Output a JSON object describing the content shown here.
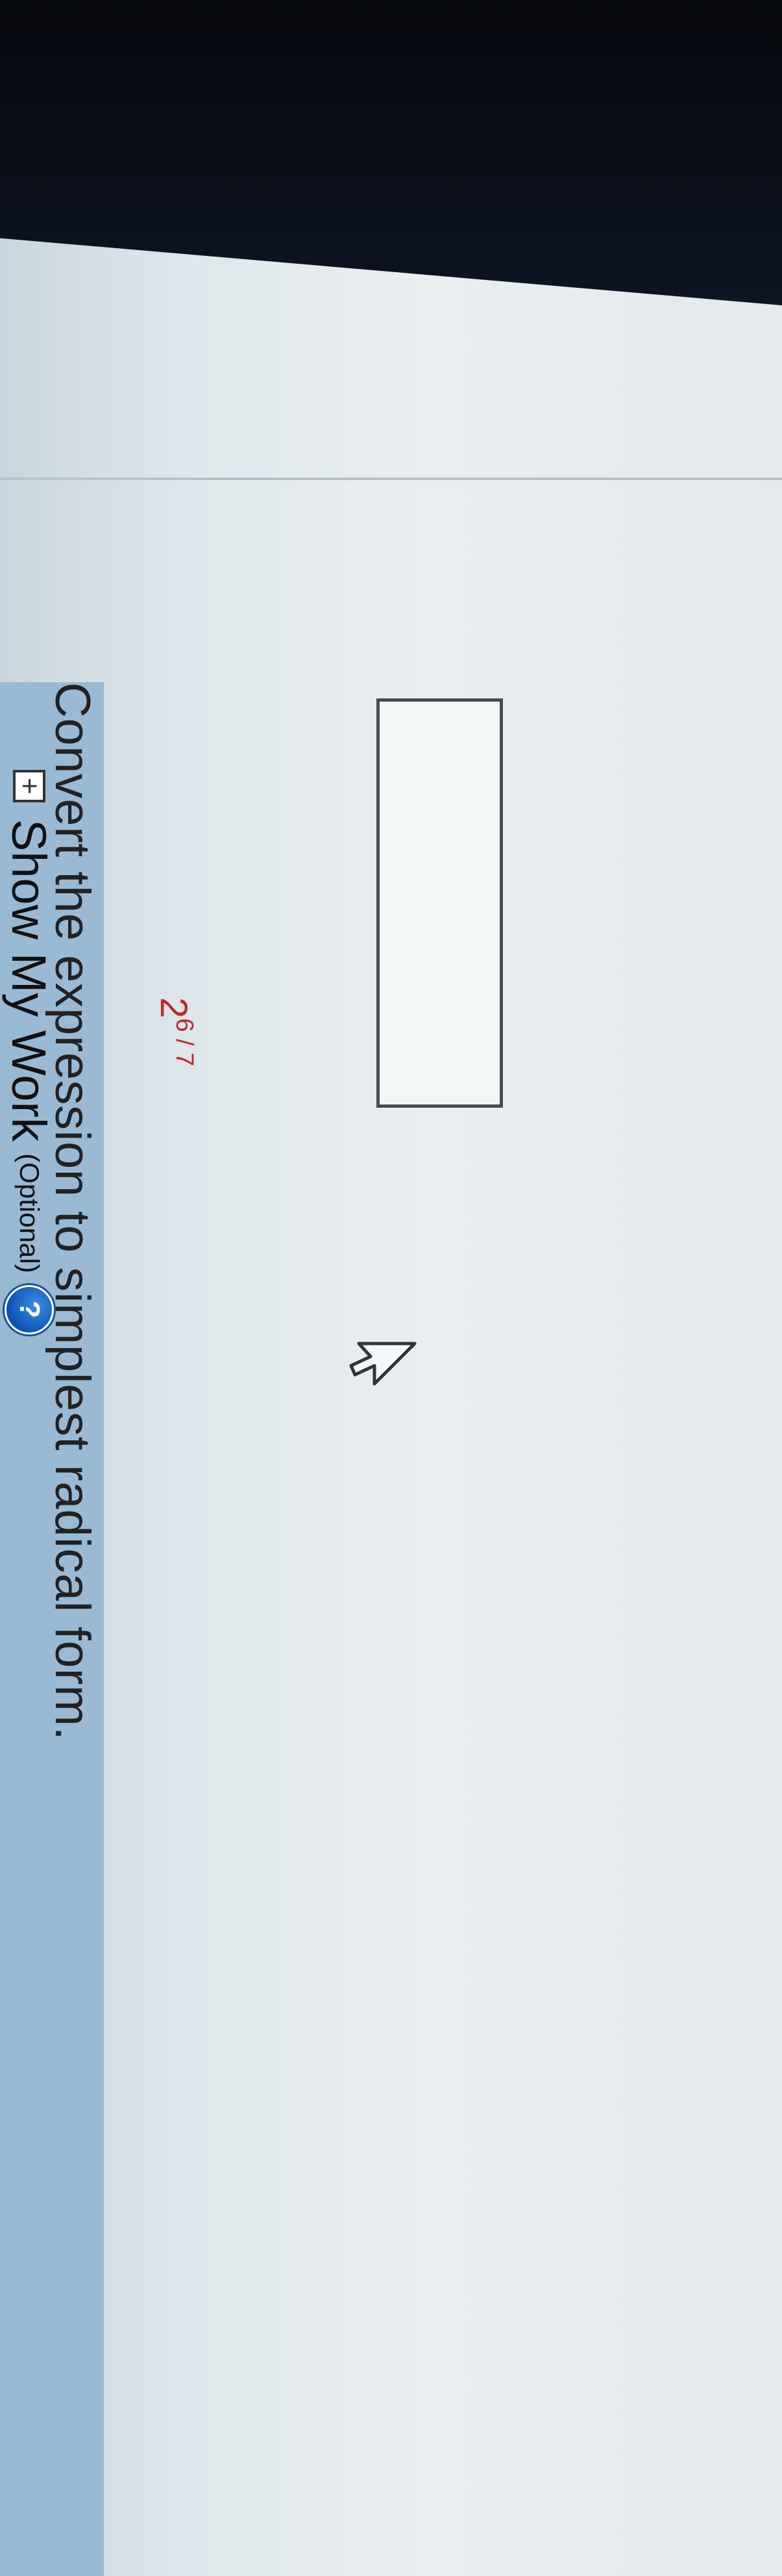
{
  "question": {
    "text": "Convert the expression to simplest radical form."
  },
  "expression": {
    "base": "2",
    "exponent": "6 / 7"
  },
  "answer": {
    "value": ""
  },
  "show_work": {
    "toggle_symbol": "+",
    "label": "Show My Work",
    "optional": "(Optional)",
    "help_symbol": "?"
  },
  "colors": {
    "expression": "#c0262d",
    "help_icon": "#0b52b8"
  },
  "icons": [
    "expand-plus-icon",
    "help-icon",
    "mouse-cursor-icon"
  ]
}
